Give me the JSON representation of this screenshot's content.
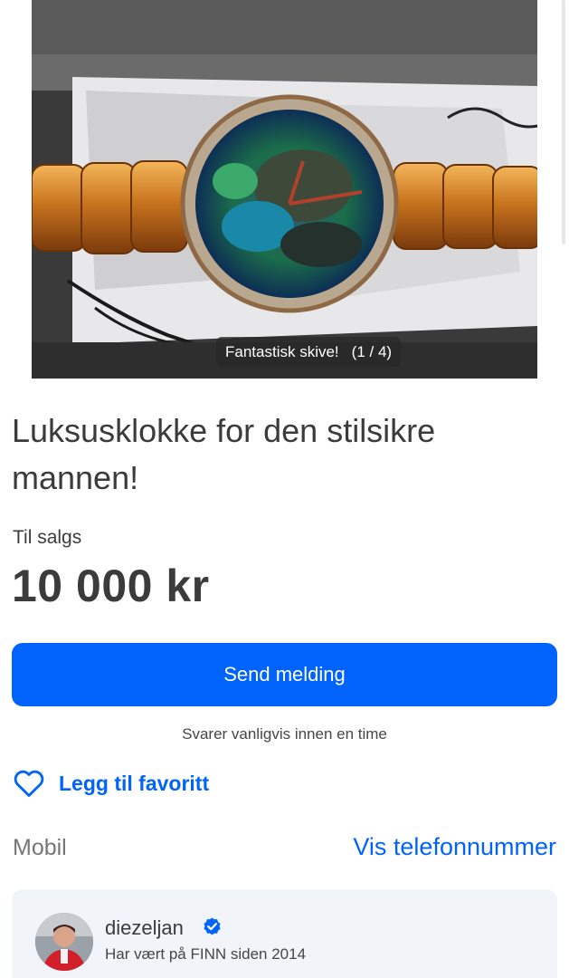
{
  "gallery": {
    "caption": "Fantastisk skive!",
    "counter": "(1 / 4)"
  },
  "listing": {
    "title": "Luksusklokke for den stilsikre mannen!",
    "sale_label": "Til salgs",
    "price": "10 000 kr"
  },
  "actions": {
    "send_message": "Send melding",
    "reply_time": "Svarer vanligvis innen en time",
    "favorite": "Legg til favoritt"
  },
  "phone": {
    "label": "Mobil",
    "link": "Vis telefonnummer"
  },
  "seller": {
    "name": "diezeljan",
    "member_since": "Har vært på FINN siden 2014"
  },
  "colors": {
    "accent": "#0063fb",
    "text": "#3b3b3b",
    "muted": "#767676",
    "card": "#f1f4f9"
  },
  "icons": [
    "heart-outline-icon",
    "verified-badge-icon"
  ]
}
